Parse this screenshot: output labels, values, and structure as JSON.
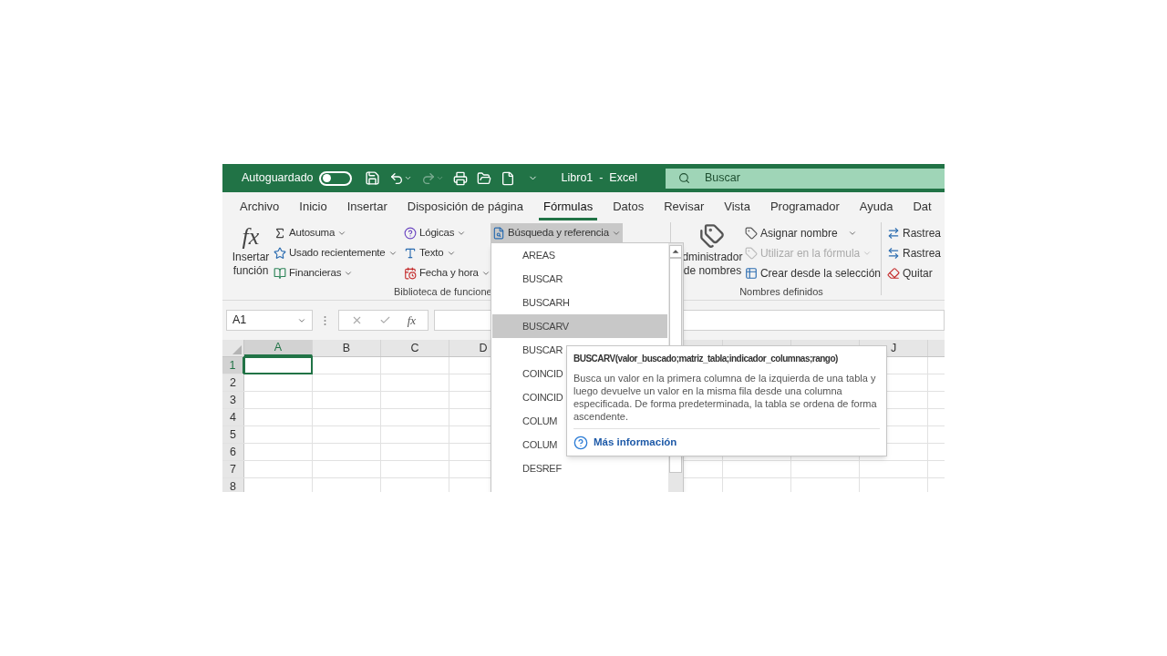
{
  "title_bar": {
    "autosave_label": "Autoguardado",
    "autosave_on": false,
    "title": "Libro1  -  Excel",
    "search": {
      "placeholder": "Buscar"
    }
  },
  "tabs": [
    {
      "label": "Archivo",
      "selected": false
    },
    {
      "label": "Inicio",
      "selected": false
    },
    {
      "label": "Insertar",
      "selected": false
    },
    {
      "label": "Disposición de página",
      "selected": false
    },
    {
      "label": "Fórmulas",
      "selected": true
    },
    {
      "label": "Datos",
      "selected": false
    },
    {
      "label": "Revisar",
      "selected": false
    },
    {
      "label": "Vista",
      "selected": false
    },
    {
      "label": "Programador",
      "selected": false
    },
    {
      "label": "Ayuda",
      "selected": false
    },
    {
      "label": "Dat",
      "selected": false
    }
  ],
  "library_group": {
    "insert_function_icon": "fx",
    "insert_function": "Insertar función",
    "label": "Biblioteca de funcione",
    "columns": [
      [
        {
          "label": "Autosuma",
          "expanded": false
        },
        {
          "label": "Usado recientemente",
          "expanded": false
        },
        {
          "label": "Financieras",
          "expanded": false
        }
      ],
      [
        {
          "label": "Lógicas",
          "expanded": false
        },
        {
          "label": "Texto",
          "expanded": false
        },
        {
          "label": "Fecha y hora",
          "expanded": false
        }
      ],
      [
        {
          "label": "Búsqueda y referencia",
          "expanded": true
        }
      ]
    ]
  },
  "names_group": {
    "manager": [
      "dministrador",
      "de nombres"
    ],
    "label": "Nombres definidos",
    "items": [
      {
        "label": "Asignar nombre",
        "disabled": false,
        "dropdown": true
      },
      {
        "label": "Utilizar en la fórmula",
        "disabled": true,
        "dropdown": true
      },
      {
        "label": "Crear desde la selección",
        "disabled": false,
        "dropdown": false
      }
    ]
  },
  "audit_group": {
    "items": [
      "Rastrea",
      "Rastrea",
      "Quitar"
    ]
  },
  "name_box": "A1",
  "formula_fx": "fx",
  "columns": [
    {
      "label": "A",
      "selected": true
    },
    {
      "label": "B",
      "selected": false
    },
    {
      "label": "C",
      "selected": false
    },
    {
      "label": "D",
      "selected": false
    },
    {
      "label": "J",
      "selected": false
    }
  ],
  "rows": [
    {
      "label": "1",
      "selected": true
    },
    {
      "label": "2",
      "selected": false
    },
    {
      "label": "3",
      "selected": false
    },
    {
      "label": "4",
      "selected": false
    },
    {
      "label": "5",
      "selected": false
    },
    {
      "label": "6",
      "selected": false
    },
    {
      "label": "7",
      "selected": false
    },
    {
      "label": "8",
      "selected": false
    }
  ],
  "dropdown": {
    "items": [
      {
        "label": "AREAS",
        "selected": false
      },
      {
        "label": "BUSCAR",
        "selected": false
      },
      {
        "label": "BUSCARH",
        "selected": false
      },
      {
        "label": "BUSCARV",
        "selected": true
      },
      {
        "label": "BUSCAR",
        "selected": false
      },
      {
        "label": "COINCID",
        "selected": false
      },
      {
        "label": "COINCID",
        "selected": false
      },
      {
        "label": "COLUM",
        "selected": false
      },
      {
        "label": "COLUM",
        "selected": false
      },
      {
        "label": "DESREF",
        "selected": false
      }
    ]
  },
  "tooltip": {
    "signature": "BUSCARV(valor_buscado;matriz_tabla;indicador_columnas;rango)",
    "description": "Busca un valor en la primera columna de la izquierda de una tabla y luego devuelve un valor en la misma fila desde una columna especificada. De forma predeterminada, la tabla se ordena de forma ascendente.",
    "link": "Más información"
  }
}
